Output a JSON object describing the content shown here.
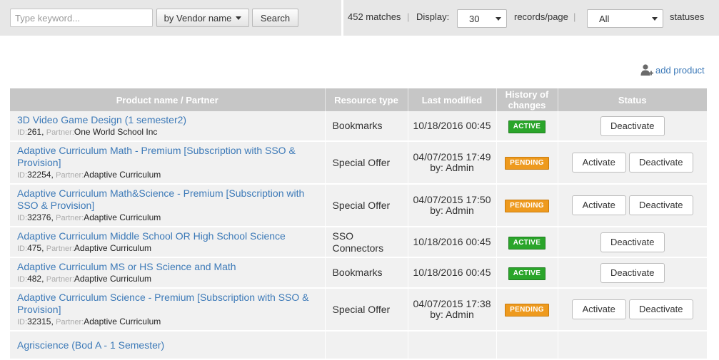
{
  "toolbar": {
    "search_placeholder": "Type keyword...",
    "vendor_filter_label": "by Vendor name",
    "search_button_label": "Search",
    "matches_text": "452 matches",
    "display_label": "Display:",
    "display_value": "30",
    "records_per_page_label": "records/page",
    "status_value": "All",
    "statuses_label": "statuses",
    "separator": "|"
  },
  "add_product_label": "add product",
  "columns": {
    "name": "Product name / Partner",
    "type": "Resource type",
    "modified": "Last modified",
    "history": "History of changes",
    "status": "Status"
  },
  "labels": {
    "id": "ID:",
    "partner": "Partner:",
    "activate": "Activate",
    "deactivate": "Deactivate"
  },
  "rows": [
    {
      "name": "3D Video Game Design (1 semester2)",
      "id": "261",
      "partner": "One World School Inc",
      "type": "Bookmarks",
      "modified": "10/18/2016 00:45",
      "by": "",
      "history": "ACTIVE"
    },
    {
      "name": "Adaptive Curriculum Math - Premium [Subscription with SSO & Provision]",
      "id": "32254",
      "partner": "Adaptive Curriculum",
      "type": "Special Offer",
      "modified": "04/07/2015 17:49",
      "by": "by:  Admin",
      "history": "PENDING"
    },
    {
      "name": "Adaptive Curriculum Math&Science - Premium [Subscription with SSO & Provision]",
      "id": "32376",
      "partner": "Adaptive Curriculum",
      "type": "Special Offer",
      "modified": "04/07/2015 17:50",
      "by": "by:  Admin",
      "history": "PENDING"
    },
    {
      "name": "Adaptive Curriculum Middle School OR High School Science",
      "id": "475",
      "partner": "Adaptive Curriculum",
      "type": "SSO Connectors",
      "modified": "10/18/2016 00:45",
      "by": "",
      "history": "ACTIVE"
    },
    {
      "name": "Adaptive Curriculum MS or HS Science and Math",
      "id": "482",
      "partner": "Adaptive Curriculum",
      "type": "Bookmarks",
      "modified": "10/18/2016 00:45",
      "by": "",
      "history": "ACTIVE"
    },
    {
      "name": "Adaptive Curriculum Science - Premium [Subscription with SSO & Provision]",
      "id": "32315",
      "partner": "Adaptive Curriculum",
      "type": "Special Offer",
      "modified": "04/07/2015 17:38",
      "by": "by:  Admin",
      "history": "PENDING"
    },
    {
      "name": "Agriscience (Bod A - 1 Semester)",
      "id": "",
      "partner": "",
      "type": "",
      "modified": "",
      "by": "",
      "history": ""
    }
  ],
  "colors": {
    "link": "#3d7ab8",
    "active": "#2aa52a",
    "pending": "#ee9a1e",
    "header": "#c6c6c6"
  }
}
